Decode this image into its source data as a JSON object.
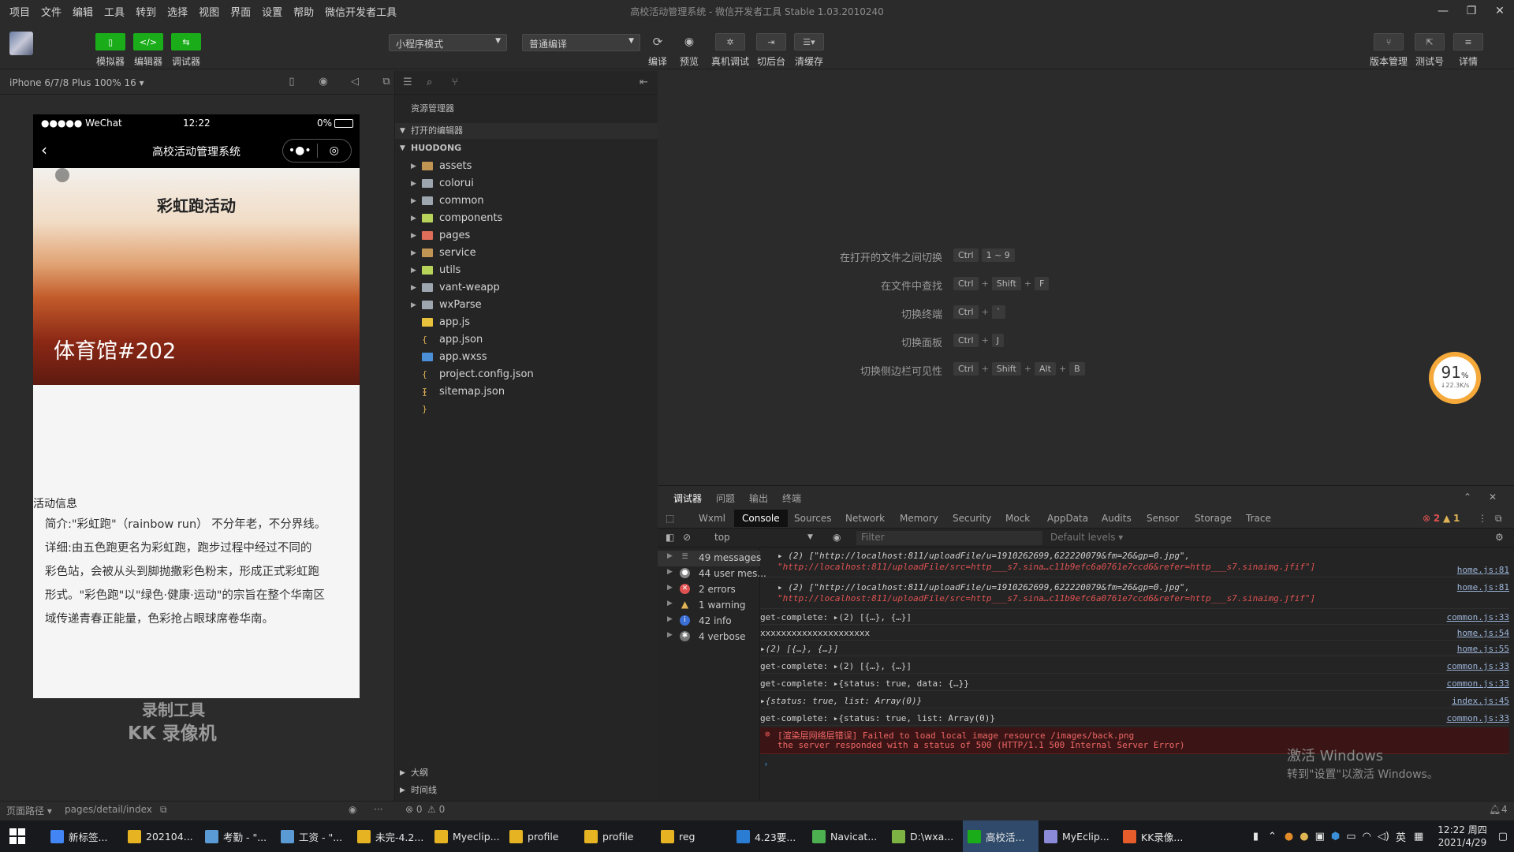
{
  "menubar": {
    "items": [
      "项目",
      "文件",
      "编辑",
      "工具",
      "转到",
      "选择",
      "视图",
      "界面",
      "设置",
      "帮助",
      "微信开发者工具"
    ],
    "title": "高校活动管理系统 - 微信开发者工具 Stable 1.03.2010240"
  },
  "toolbar": {
    "simulator_label": "模拟器",
    "editor_label": "编辑器",
    "debugger_label": "调试器",
    "mode_select": "小程序模式",
    "compile_select": "普通编译",
    "compile_label": "编译",
    "preview_label": "预览",
    "remote_debug_label": "真机调试",
    "background_label": "切后台",
    "clear_cache_label": "清缓存",
    "version_label": "版本管理",
    "test_label": "测试号",
    "details_label": "详情"
  },
  "simulator": {
    "device": "iPhone 6/7/8 Plus 100% 16 ▾",
    "status_left": "●●●●● WeChat",
    "status_time": "12:22",
    "status_battery": "0%",
    "nav_title": "高校活动管理系统",
    "hero_title": "彩虹跑活动",
    "hero_subtitle": "体育馆#202",
    "section_title": "活动信息",
    "desc_lines": [
      "简介:\"彩虹跑\"（rainbow run） 不分年老，不分界线。",
      "详细:由五色跑更名为彩虹跑，跑步过程中经过不同的",
      "彩色站，会被从头到脚抛撒彩色粉末，形成正式彩虹跑",
      "形式。\"彩色跑\"以\"绿色·健康·运动\"的宗旨在整个华南区",
      "域传递青春正能量，色彩抢占眼球席卷华南。"
    ],
    "watermark_line1": "录制工具",
    "watermark_line2": "KK 录像机"
  },
  "explorer": {
    "header": "资源管理器",
    "open_editors": "打开的编辑器",
    "project": "HUODONG",
    "items": [
      {
        "name": "assets",
        "type": "folder"
      },
      {
        "name": "colorui",
        "type": "folder"
      },
      {
        "name": "common",
        "type": "folder"
      },
      {
        "name": "components",
        "type": "folder"
      },
      {
        "name": "pages",
        "type": "folder"
      },
      {
        "name": "service",
        "type": "folder"
      },
      {
        "name": "utils",
        "type": "folder"
      },
      {
        "name": "vant-weapp",
        "type": "folder"
      },
      {
        "name": "wxParse",
        "type": "folder"
      },
      {
        "name": "app.js",
        "type": "js"
      },
      {
        "name": "app.json",
        "type": "json"
      },
      {
        "name": "app.wxss",
        "type": "wxss"
      },
      {
        "name": "project.config.json",
        "type": "json"
      },
      {
        "name": "sitemap.json",
        "type": "json"
      }
    ],
    "outline": "大纲",
    "timeline": "时间线"
  },
  "shortcuts": [
    {
      "label": "在打开的文件之间切换",
      "keys": [
        "Ctrl",
        "1 ~ 9"
      ]
    },
    {
      "label": "在文件中查找",
      "keys": [
        "Ctrl",
        "Shift",
        "F"
      ]
    },
    {
      "label": "切换终端",
      "keys": [
        "Ctrl",
        "`"
      ]
    },
    {
      "label": "切换面板",
      "keys": [
        "Ctrl",
        "J"
      ]
    },
    {
      "label": "切换侧边栏可见性",
      "keys": [
        "Ctrl",
        "Shift",
        "Alt",
        "B"
      ]
    }
  ],
  "gauge": {
    "percent": "91",
    "unit": "%",
    "speed": "↓22.3K/s"
  },
  "devtools": {
    "top_tabs": [
      "调试器",
      "问题",
      "输出",
      "终端"
    ],
    "tabs": [
      "Wxml",
      "Console",
      "Sources",
      "Network",
      "Memory",
      "Security",
      "Mock",
      "AppData",
      "Audits",
      "Sensor",
      "Storage",
      "Trace"
    ],
    "error_count": "2",
    "warning_count": "1",
    "context": "top",
    "filter_placeholder": "Filter",
    "levels": "Default levels ▾",
    "sidebar": [
      {
        "label": "49 messages",
        "icon": "list-icon"
      },
      {
        "label": "44 user mes...",
        "icon": "user-icon"
      },
      {
        "label": "2 errors",
        "icon": "error-icon"
      },
      {
        "label": "1 warning",
        "icon": "warning-icon"
      },
      {
        "label": "42 info",
        "icon": "info-icon"
      },
      {
        "label": "4 verbose",
        "icon": "verbose-icon"
      }
    ],
    "logs": [
      {
        "text": "▸ (2) [\"http://localhost:811/uploadFile/u=1910262699,622220079&fm=26&gp=0.jpg\",",
        "text2": "   \"http://localhost:811/uploadFile/src=http___s7.sina…c11b9efc6a0761e7ccd6&refer=http___s7.sinaimg.jfif\"]",
        "src": "home.js:81"
      },
      {
        "text": "▸ (2) [\"http://localhost:811/uploadFile/u=1910262699,622220079&fm=26&gp=0.jpg\",",
        "text2": "   \"http://localhost:811/uploadFile/src=http___s7.sina…c11b9efc6a0761e7ccd6&refer=http___s7.sinaimg.jfif\"]",
        "src": "home.js:81"
      },
      {
        "text": "get-complete: ▸(2) [{…}, {…}]",
        "src": "common.js:33"
      },
      {
        "text": "xxxxxxxxxxxxxxxxxxxxx",
        "src": "home.js:54"
      },
      {
        "text": "▸(2) [{…}, {…}]",
        "src": "home.js:55"
      },
      {
        "text": "get-complete: ▸(2) [{…}, {…}]",
        "src": "common.js:33"
      },
      {
        "text": "get-complete: ▸{status: true, data: {…}}",
        "src": "common.js:33"
      },
      {
        "text": "▸{status: true, list: Array(0)}",
        "src": "index.js:45"
      },
      {
        "text": "get-complete: ▸{status: true, list: Array(0)}",
        "src": "common.js:33"
      }
    ],
    "error_line1": "[渲染层网络层错误] Failed to load local image resource /images/back.png",
    "error_line2": " the server responded with a status of 500 (HTTP/1.1 500 Internal Server Error)",
    "activate_title": "激活 Windows",
    "activate_sub": "转到\"设置\"以激活 Windows。"
  },
  "statusbar": {
    "page_path_label": "页面路径 ▾",
    "page_path": "pages/detail/index",
    "errors": "⊗ 0",
    "warnings": "⚠ 0",
    "bell": "4"
  },
  "taskbar": {
    "items": [
      {
        "label": "新标签...",
        "color": "#4285f4"
      },
      {
        "label": "202104...",
        "color": "#e6b422"
      },
      {
        "label": "考勤 - \"...",
        "color": "#5b9bd5"
      },
      {
        "label": "工资 - \"...",
        "color": "#5b9bd5"
      },
      {
        "label": "未完-4.2...",
        "color": "#e6b422"
      },
      {
        "label": "Myeclip...",
        "color": "#e6b422"
      },
      {
        "label": "profile",
        "color": "#e6b422"
      },
      {
        "label": "profile",
        "color": "#e6b422"
      },
      {
        "label": "reg",
        "color": "#e6b422"
      },
      {
        "label": "4.23要...",
        "color": "#2b7cd3"
      },
      {
        "label": "Navicat...",
        "color": "#4caf50"
      },
      {
        "label": "D:\\wxa...",
        "color": "#7cb342"
      },
      {
        "label": "高校活...",
        "color": "#1aad19"
      },
      {
        "label": "MyEclip...",
        "color": "#8a8ad8"
      },
      {
        "label": "KK录像...",
        "color": "#e65c2a"
      }
    ],
    "ime": "英",
    "time": "12:22 周四",
    "date": "2021/4/29"
  }
}
